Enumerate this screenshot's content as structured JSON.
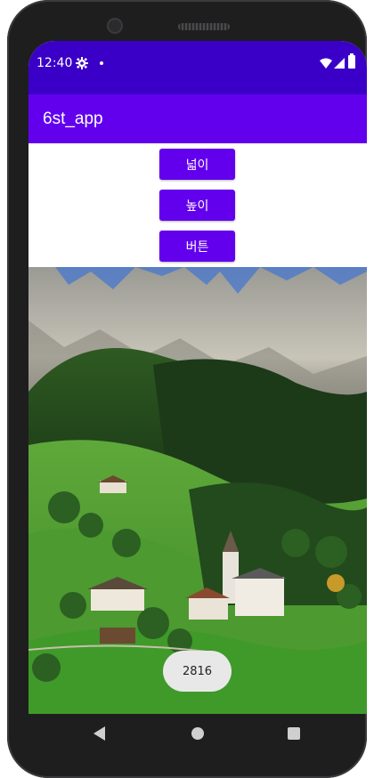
{
  "status_bar": {
    "time": "12:40",
    "icons": [
      "gear-icon",
      "dot-icon",
      "wifi-icon",
      "signal-icon",
      "battery-icon"
    ],
    "color": "#3b00c8"
  },
  "app_bar": {
    "title": "6st_app",
    "color": "#6200ee"
  },
  "buttons": [
    {
      "label": "넓이"
    },
    {
      "label": "높이"
    },
    {
      "label": "버튼"
    }
  ],
  "image": {
    "description_icon": "landscape-photo"
  },
  "toast": {
    "text": "2816"
  },
  "nav_bar": {
    "icons": [
      "back-icon",
      "home-icon",
      "recents-icon"
    ]
  }
}
